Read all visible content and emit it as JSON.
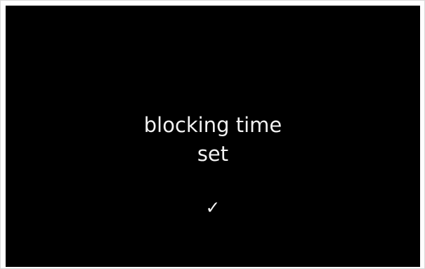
{
  "screen": {
    "message_line1": "blocking time",
    "message_line2": "set",
    "confirm_icon": "check-icon",
    "confirm_glyph": "✓"
  },
  "colors": {
    "background": "#000000",
    "text": "#f2f2f2",
    "frame_border": "#d8d8d8"
  }
}
